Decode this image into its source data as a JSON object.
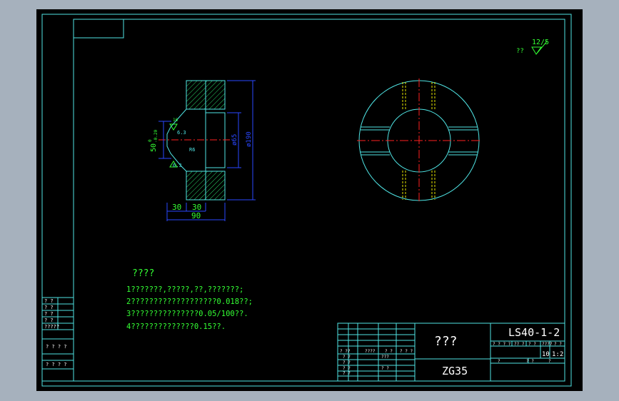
{
  "colors": {
    "background": "#a6b1bd",
    "paper": "#000000",
    "frame": "#4fe3e3",
    "dim": "#2a47ff",
    "text": "#34ff34",
    "center": "#ff2020",
    "hidden": "#e6e600",
    "hatch": "#2bd96a"
  },
  "corner_mark": {
    "roughness_value": "12/5",
    "label": "??"
  },
  "part_dims": {
    "top_tol": "0",
    "bottom_tol": "-0.20",
    "dim_50": "50",
    "dim_65": "ø65",
    "dim_190": "ø190",
    "dim_r6": "R6",
    "rough_63_top": "6.3",
    "rough_63_bottom": "6.3",
    "rough_top_mark": "16",
    "dim_30_left": "30",
    "dim_30_right": "30",
    "dim_90": "90"
  },
  "notes": {
    "title": "????",
    "lines": [
      "1???????,?????,??,???????;",
      "2???????????????????0.018??;",
      "3???????????????0.05/100??.",
      "4??????????????0.15??."
    ]
  },
  "left_table": {
    "rows": [
      "? ?",
      "? ?",
      "? ?",
      "? ?",
      "?????"
    ],
    "row2": "? ? ? ?",
    "row3": "? ? ? ?"
  },
  "title_block": {
    "part_name": "???",
    "material": "ZG35",
    "drawing_no": "LS40-1-2",
    "quantity": "10",
    "scale": "1:2",
    "headers": [
      "? ? ? ?",
      "?? ?",
      "? ?",
      "????",
      "? ?"
    ],
    "sheet_labels": [
      "?",
      "? ?",
      "?"
    ],
    "left_labels": [
      "? ??",
      "????",
      "? ?",
      "? ? ?",
      "? ?",
      "???",
      "? ?",
      "? ?",
      "? ?",
      "? ?"
    ]
  }
}
